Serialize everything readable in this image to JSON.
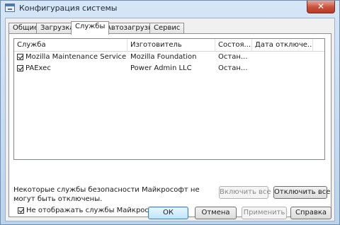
{
  "window": {
    "title": "Конфигурация системы",
    "close_label": "✕"
  },
  "tabs": [
    {
      "label": "Общие"
    },
    {
      "label": "Загрузка"
    },
    {
      "label": "Службы"
    },
    {
      "label": "Автозагрузка"
    },
    {
      "label": "Сервис"
    }
  ],
  "services": {
    "columns": [
      "Служба",
      "Изготовитель",
      "Состоя...",
      "Дата отключе..."
    ],
    "rows": [
      {
        "checked": true,
        "service": "Mozilla Maintenance Service",
        "manufacturer": "Mozilla Foundation",
        "status": "Остан..."
      },
      {
        "checked": true,
        "service": "PAExec",
        "manufacturer": "Power Admin LLC",
        "status": "Остан..."
      }
    ]
  },
  "note": "Некоторые службы безопасности Майкрософт не могут быть отключены.",
  "enable_all_label": "Включить все",
  "disable_all_label": "Отключить все",
  "hide_ms_label": "Не отображать службы Майкрософт",
  "buttons": {
    "ok": "ОК",
    "cancel": "Отмена",
    "apply": "Применить",
    "help": "Справка"
  }
}
